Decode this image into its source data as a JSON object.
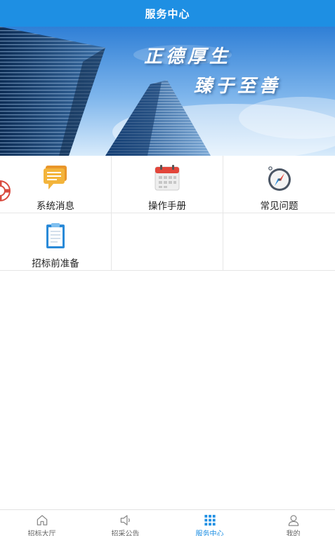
{
  "header": {
    "title": "服务中心"
  },
  "banner": {
    "slogan_line1": "正德厚生",
    "slogan_line2": "臻于至善"
  },
  "services": [
    {
      "label": "系统消息",
      "icon": "message-icon"
    },
    {
      "label": "操作手册",
      "icon": "calendar-icon"
    },
    {
      "label": "常见问题",
      "icon": "compass-icon"
    },
    {
      "label": "招标前准备",
      "icon": "clipboard-icon"
    }
  ],
  "tabs": [
    {
      "label": "招标大厅",
      "icon": "home-icon",
      "active": false
    },
    {
      "label": "招采公告",
      "icon": "speaker-icon",
      "active": false
    },
    {
      "label": "服务中心",
      "icon": "grid-icon",
      "active": true
    },
    {
      "label": "我的",
      "icon": "user-icon",
      "active": false
    }
  ],
  "colors": {
    "accent": "#1e8fe3",
    "text": "#222222",
    "tab_inactive": "#666666"
  }
}
